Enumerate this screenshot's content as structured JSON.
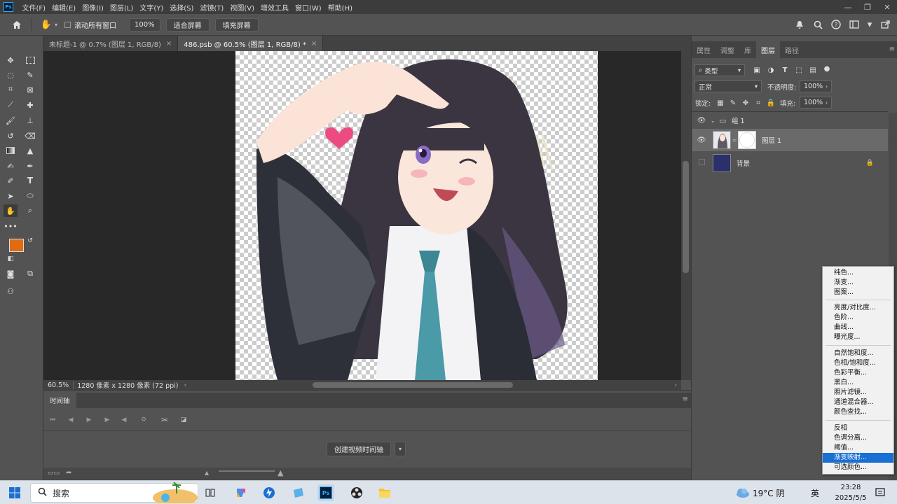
{
  "app": {
    "logo": "Ps"
  },
  "menubar": {
    "items": [
      "文件(F)",
      "编辑(E)",
      "图像(I)",
      "图层(L)",
      "文字(Y)",
      "选择(S)",
      "滤镜(T)",
      "视图(V)",
      "增效工具",
      "窗口(W)",
      "帮助(H)"
    ],
    "window_controls": [
      "—",
      "❐",
      "✕"
    ]
  },
  "options": {
    "scroll_all_label": "滚动所有窗口",
    "zoom_value": "100%",
    "fit_screen": "适合屏幕",
    "fill_screen": "填充屏幕"
  },
  "doc_tabs": [
    {
      "label": "未标题-1 @ 0.7% (图层 1, RGB/8)",
      "close": "×"
    },
    {
      "label": "486.psb @ 60.5% (图层 1, RGB/8) *",
      "close": "×"
    }
  ],
  "status": {
    "zoom": "60.5%",
    "doc_info": "1280 像素 x 1280 像素 (72 ppi)"
  },
  "timeline": {
    "tab": "时间轴",
    "create_button": "创建视频时间轴"
  },
  "panel": {
    "tabs": [
      "属性",
      "调整",
      "库",
      "图层",
      "路径"
    ],
    "active_tab": "图层",
    "filter_kind": "类型",
    "blend_mode": "正常",
    "opacity_label": "不透明度:",
    "opacity_value": "100%",
    "lock_label": "锁定:",
    "fill_label": "填充:",
    "fill_value": "100%",
    "layers": {
      "group": "组 1",
      "layer1": "图层 1",
      "background": "背景"
    }
  },
  "context_menu": {
    "items": [
      "纯色...",
      "渐变...",
      "图案...",
      "亮度/对比度...",
      "色阶...",
      "曲线...",
      "曝光度...",
      "自然饱和度...",
      "色相/饱和度...",
      "色彩平衡...",
      "黑白...",
      "照片滤镜...",
      "通道混合器...",
      "颜色查找...",
      "反相",
      "色调分离...",
      "阈值...",
      "渐变映射...",
      "可选颜色..."
    ],
    "highlighted": "渐变映射..."
  },
  "taskbar": {
    "search": "搜索",
    "weather": "19°C 阴",
    "ime": "英",
    "time": "23:28",
    "date": "2025/5/5"
  },
  "colors": {
    "foreground": "#e06b10",
    "background": "#2b2f6b",
    "accent": "#1870d5"
  }
}
